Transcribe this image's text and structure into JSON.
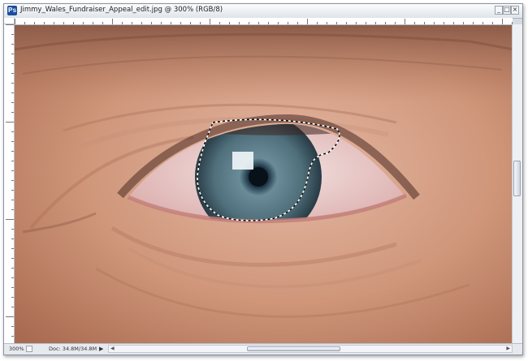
{
  "window": {
    "title": "Jimmy_Wales_Fundraiser_Appeal_edit.jpg @ 300% (RGB/8)",
    "app_icon": "Ps",
    "buttons": [
      "minimize-icon",
      "maximize-icon",
      "close-icon"
    ]
  },
  "canvas": {
    "content": "close-up photo of an eye with a dotted marquee selection around the iris",
    "selection": "marching-ants-selection"
  },
  "status": {
    "zoom": "300%",
    "doc_info": "Doc: 34.8M/34.8M"
  },
  "colors": {
    "chrome": "#d6dbe3",
    "skin": "#cf967a",
    "iris": "#5a7a85"
  }
}
